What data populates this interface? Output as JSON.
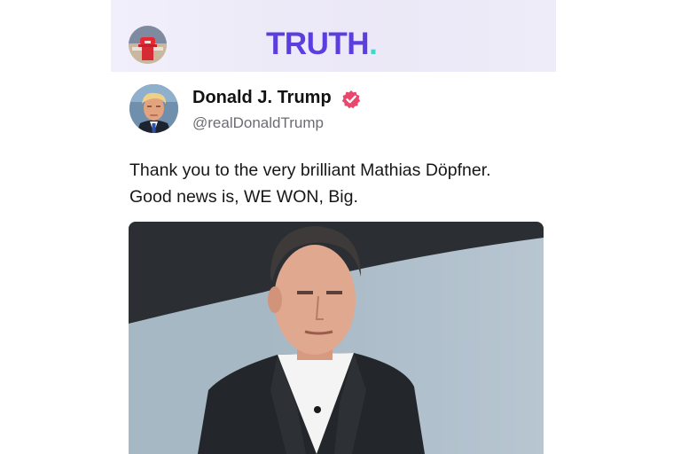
{
  "app": {
    "brand_name": "TRUTH",
    "brand_dot": ".",
    "brand_color": "#5c3ee0",
    "dot_color": "#41d6c5",
    "header_avatar_icon": "profile-photo-icon"
  },
  "post": {
    "author_name": "Donald J. Trump",
    "author_handle": "@realDonaldTrump",
    "verified_icon": "verified-badge-icon",
    "verified_color": "#e8476e",
    "text_line_1": "Thank you to the very brilliant Mathias Döpfner.",
    "text_line_2": "Good news is, WE WON, Big."
  }
}
